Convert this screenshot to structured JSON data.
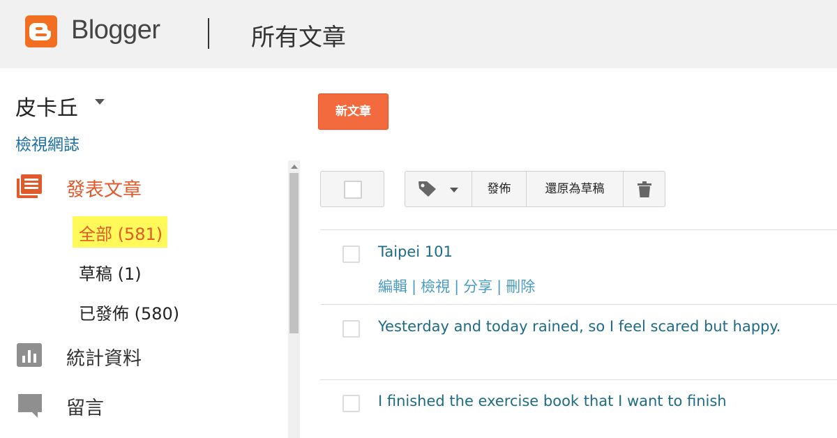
{
  "header": {
    "brand": "Blogger",
    "title": "所有文章"
  },
  "sidebar": {
    "blog_name": "皮卡丘",
    "view_blog": "檢視網誌",
    "nav": {
      "posts": "發表文章",
      "stats": "統計資料",
      "comments": "留言"
    },
    "sub_items": {
      "all": "全部 (581)",
      "drafts": "草稿 (1)",
      "published": "已發佈 (580)"
    }
  },
  "main": {
    "new_post": "新文章",
    "toolbar": {
      "publish": "發佈",
      "revert": "還原為草稿"
    },
    "posts": [
      {
        "title": "Taipei 101"
      },
      {
        "title": "Yesterday and today rained, so I feel scared but happy."
      },
      {
        "title": "I finished the exercise book that I want to finish"
      }
    ],
    "post_actions": {
      "edit": "編輯",
      "view": "檢視",
      "share": "分享",
      "delete": "刪除",
      "separator": "|"
    }
  },
  "colors": {
    "brand_orange": "#f26f21",
    "accent": "#e15a2b",
    "highlight": "#fff95a",
    "link": "#1e6b86"
  },
  "icons": {
    "logo": "blogger-logo-icon",
    "posts": "posts-icon",
    "stats": "stats-icon",
    "comments": "comments-icon",
    "label": "label-tag-icon",
    "trash": "trash-icon"
  }
}
